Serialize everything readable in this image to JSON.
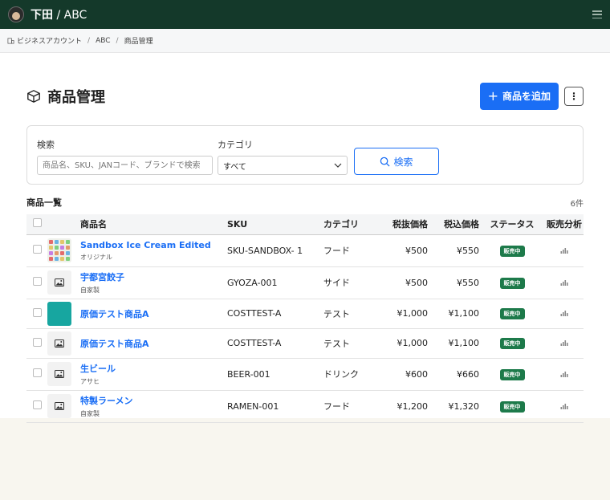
{
  "topbar": {
    "user": "下田",
    "org": "ABC"
  },
  "breadcrumb": {
    "items": [
      "ビジネスアカウント",
      "ABC",
      "商品管理"
    ]
  },
  "page": {
    "title": "商品管理",
    "add_button": "商品を追加"
  },
  "filter": {
    "search_label": "検索",
    "search_placeholder": "商品名、SKU、JANコード、ブランドで検索",
    "category_label": "カテゴリ",
    "category_value": "すべて",
    "search_button": "検索"
  },
  "list": {
    "title": "商品一覧",
    "count": "6件"
  },
  "columns": {
    "name": "商品名",
    "sku": "SKU",
    "category": "カテゴリ",
    "price_ex": "税抜価格",
    "price_in": "税込価格",
    "status": "ステータス",
    "analysis": "販売分析"
  },
  "rows": [
    {
      "name": "Sandbox Ice Cream Edited",
      "sub": "オリジナル",
      "sku": "SKU-SANDBOX- 1",
      "category": "フード",
      "price_ex": "¥500",
      "price_in": "¥550",
      "status": "販売中",
      "thumb": "pattern"
    },
    {
      "name": "宇都宮餃子",
      "sub": "自家製",
      "sku": "GYOZA-001",
      "category": "サイド",
      "price_ex": "¥500",
      "price_in": "¥550",
      "status": "販売中",
      "thumb": "image-placeholder-icon"
    },
    {
      "name": "原価テスト商品A",
      "sub": "",
      "sku": "COSTTEST-A",
      "category": "テスト",
      "price_ex": "¥1,000",
      "price_in": "¥1,100",
      "status": "販売中",
      "thumb": "teal"
    },
    {
      "name": "原価テスト商品A",
      "sub": "",
      "sku": "COSTTEST-A",
      "category": "テスト",
      "price_ex": "¥1,000",
      "price_in": "¥1,100",
      "status": "販売中",
      "thumb": "image-placeholder-icon"
    },
    {
      "name": "生ビール",
      "sub": "アサヒ",
      "sku": "BEER-001",
      "category": "ドリンク",
      "price_ex": "¥600",
      "price_in": "¥660",
      "status": "販売中",
      "thumb": "image-placeholder-icon"
    },
    {
      "name": "特製ラーメン",
      "sub": "自家製",
      "sku": "RAMEN-001",
      "category": "フード",
      "price_ex": "¥1,200",
      "price_in": "¥1,320",
      "status": "販売中",
      "thumb": "image-placeholder-icon"
    }
  ],
  "colors": {
    "topbar": "#14392a",
    "primary": "#1a6ef5",
    "badge": "#1d7a4a",
    "thumb_teal": "#17a6a0"
  }
}
